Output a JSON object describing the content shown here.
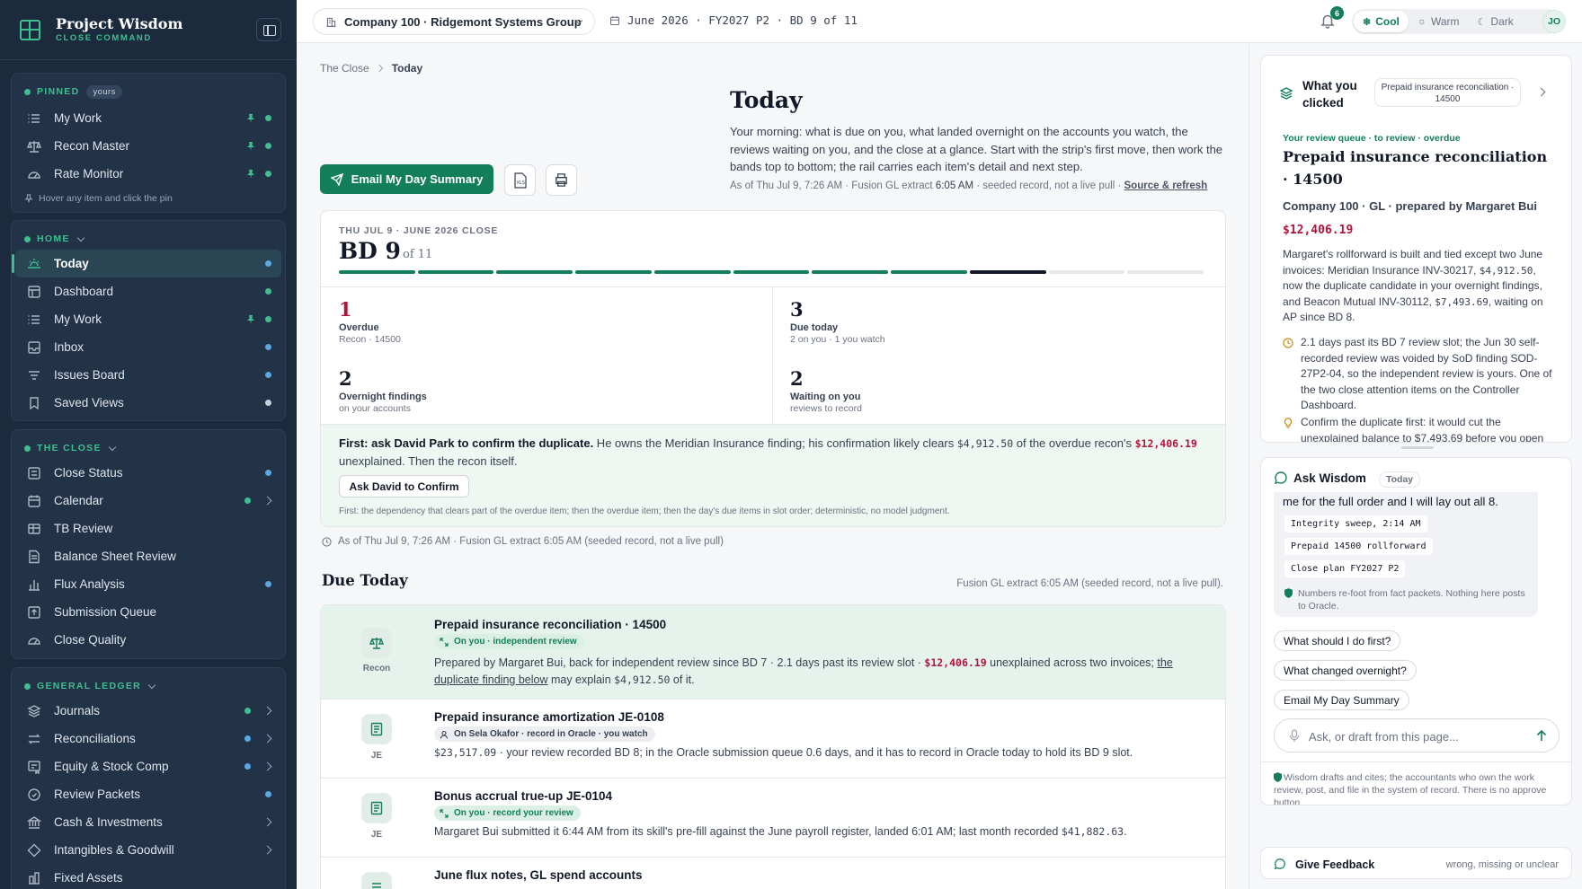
{
  "brand": {
    "title": "Project Wisdom",
    "subtitle": "CLOSE COMMAND"
  },
  "sidebar": {
    "pinned": {
      "label": "PINNED",
      "badge": "yours",
      "items": [
        {
          "label": "My Work",
          "icon": "list-icon"
        },
        {
          "label": "Recon Master",
          "icon": "scale-icon"
        },
        {
          "label": "Rate Monitor",
          "icon": "gauge-icon"
        }
      ],
      "hint": "Hover any item and click the pin"
    },
    "home": {
      "label": "HOME",
      "items": [
        {
          "label": "Today",
          "icon": "sunrise-icon",
          "active": true,
          "dot": "blue"
        },
        {
          "label": "Dashboard",
          "icon": "grid-icon",
          "dot": "green"
        },
        {
          "label": "My Work",
          "icon": "list-icon",
          "pinned": true,
          "dot": "green"
        },
        {
          "label": "Inbox",
          "icon": "inbox-icon",
          "dot": "blue"
        },
        {
          "label": "Issues Board",
          "icon": "filter-icon",
          "dot": "blue"
        },
        {
          "label": "Saved Views",
          "icon": "bookmark-icon",
          "dot": "white"
        }
      ]
    },
    "the_close": {
      "label": "THE CLOSE",
      "items": [
        {
          "label": "Close Status",
          "icon": "checklist-icon",
          "dot": "blue"
        },
        {
          "label": "Calendar",
          "icon": "calendar-icon",
          "dot": "green",
          "chevron": true
        },
        {
          "label": "TB Review",
          "icon": "table-icon"
        },
        {
          "label": "Balance Sheet Review",
          "icon": "document-icon"
        },
        {
          "label": "Flux Analysis",
          "icon": "bar-chart-icon",
          "dot": "blue"
        },
        {
          "label": "Submission Queue",
          "icon": "upload-icon"
        },
        {
          "label": "Close Quality",
          "icon": "gauge-icon"
        }
      ]
    },
    "general_ledger": {
      "label": "GENERAL LEDGER",
      "items": [
        {
          "label": "Journals",
          "icon": "layers-icon",
          "dot": "green",
          "chevron": true
        },
        {
          "label": "Reconciliations",
          "icon": "swap-icon",
          "dot": "blue",
          "chevron": true
        },
        {
          "label": "Equity & Stock Comp",
          "icon": "certificate-icon",
          "dot": "blue",
          "chevron": true
        },
        {
          "label": "Review Packets",
          "icon": "badge-icon",
          "dot": "blue"
        },
        {
          "label": "Cash & Investments",
          "icon": "bank-icon",
          "chevron": true
        },
        {
          "label": "Intangibles & Goodwill",
          "icon": "diamond-icon",
          "chevron": true
        },
        {
          "label": "Fixed Assets",
          "icon": "building-icon"
        }
      ]
    }
  },
  "topbar": {
    "company": "Company 100 · Ridgemont Systems Group",
    "period": "June 2026 · FY2027 P2 · BD 9 of 11",
    "notifications": "6",
    "themes": [
      "Cool",
      "Warm",
      "Dark"
    ],
    "active_theme": "Cool",
    "avatar": "JO"
  },
  "main": {
    "breadcrumb": [
      "The Close",
      "Today"
    ],
    "title": "Today",
    "intro": "Your morning: what is due on you, what landed overnight on the accounts you watch, the reviews waiting on you, and the close at a glance. Start with the strip's first move, then work the bands top to bottom; the rail carries each item's detail and next step.",
    "asof_prefix": "As of Thu Jul 9, 7:26 AM · Fusion GL extract ",
    "asof_time": "6:05 AM",
    "asof_suffix": " · seeded record, not a live pull ·",
    "source_link": "Source & refresh",
    "email_button": "Email My Day Summary",
    "xls_label": "XLS",
    "bd": {
      "kicker": "THU JUL 9 · JUNE 2026 CLOSE",
      "big": "BD 9",
      "of": "of 11",
      "total_days": 11,
      "completed_days": 8,
      "current_day": 9
    },
    "stats": [
      {
        "number": "1",
        "label": "Overdue",
        "sub": "Recon · 14500",
        "red": true
      },
      {
        "number": "3",
        "label": "Due today",
        "sub": "2 on you · 1 you watch"
      },
      {
        "number": "2",
        "label": "Overnight findings",
        "sub": "on your accounts"
      },
      {
        "number": "2",
        "label": "Waiting on you",
        "sub": "reviews to record"
      }
    ],
    "first_move": {
      "lead": "First: ask David Park to confirm the duplicate.",
      "t1": " He owns the Meridian Insurance finding; his confirmation likely clears ",
      "amt1": "$4,912.50",
      "t2": " of the overdue recon's ",
      "amt2": "$12,406.19",
      "t3": " unexplained. Then the recon itself.",
      "button": "Ask David to Confirm",
      "note": "First: the dependency that clears part of the overdue item; then the overdue item; then the day's due items in slot order; deterministic, no model judgment."
    },
    "asof2": "As of Thu Jul 9, 7:26 AM · Fusion GL extract 6:05 AM (seeded record, not a live pull)",
    "due_today": {
      "title": "Due Today",
      "source": "Fusion GL extract 6:05 AM (seeded record, not a live pull).",
      "items": [
        {
          "type": "Recon",
          "title": "Prepaid insurance reconciliation · 14500",
          "tag": "On you · independent review",
          "d1": "Prepared by Margaret Bui, back for independent review since BD 7 · 2.1 days past its review slot · ",
          "amt": "$12,406.19",
          "d2": " unexplained across two invoices; ",
          "link": "the duplicate finding below",
          "d3": " may explain ",
          "amt2": "$4,912.50",
          "d4": " of it."
        },
        {
          "type": "JE",
          "title": "Prepaid insurance amortization JE-0108",
          "tag": "On Sela Okafor · record in Oracle · you watch",
          "amt": "$23,517.09",
          "d1": " · your review recorded BD 8; in the Oracle submission queue 0.6 days, and it has to record in Oracle today to hold its BD 9 slot."
        },
        {
          "type": "JE",
          "title": "Bonus accrual true-up JE-0104",
          "tag": "On you · record your review",
          "d1": "Margaret Bui submitted it 6:44 AM from its skill's pre-fill against the June payroll register, landed 6:01 AM; last month recorded ",
          "amt": "$41,882.63",
          "d2": "."
        },
        {
          "type": "",
          "title": "June flux notes, GL spend accounts"
        }
      ]
    }
  },
  "rail": {
    "what_you_clicked": {
      "title": "What you clicked",
      "pill": "Prepaid insurance reconciliation · 14500",
      "kicker": "Your review queue · to review · overdue",
      "heading": "Prepaid insurance reconciliation · 14500",
      "sub": "Company 100 · GL · prepared by Margaret Bui",
      "amount": "$12,406.19",
      "b1": "Margaret's rollforward is built and tied except two June invoices: Meridian Insurance INV-30217, ",
      "b_amt1": "$4,912.50",
      "b2": ", now the duplicate candidate in your overnight findings, and Beacon Mutual INV-30112, ",
      "b_amt2": "$7,493.69",
      "b3": ", waiting on AP since BD 8.",
      "li1": "2.1 days past its BD 7 review slot; the Jun 30 self-recorded review was voided by SoD finding SOD-27P2-04, so the independent review is yours. One of the two close attention items on the Controller Dashboard.",
      "li2": "Confirm the duplicate first: it would cut the unexplained balance to $7,493.69 before you open Sylvia's working paper."
    },
    "ask_wisdom": {
      "title": "Ask Wisdom",
      "badge": "Today",
      "message_tail": "me for the full order and I will lay out all 8.",
      "chips": [
        "Integrity sweep, 2:14 AM",
        "Prepaid 14500 rollforward",
        "Close plan FY2027 P2"
      ],
      "note": "Numbers re-foot from fact packets. Nothing here posts to Oracle.",
      "suggestions": [
        "What should I do first?",
        "What changed overnight?",
        "Email My Day Summary"
      ],
      "placeholder": "Ask, or draft from this page...",
      "footer": "Wisdom drafts and cites; the accountants who own the work review, post, and file in the system of record. There is no approve button."
    },
    "feedback": {
      "title": "Give Feedback",
      "note": "wrong, missing or unclear"
    }
  },
  "colors": {
    "sidebar_bg": "#1c2a3d",
    "accent_green": "#127f5a",
    "alert_red": "#b3143c",
    "highlight_row": "#e6f2ec"
  }
}
